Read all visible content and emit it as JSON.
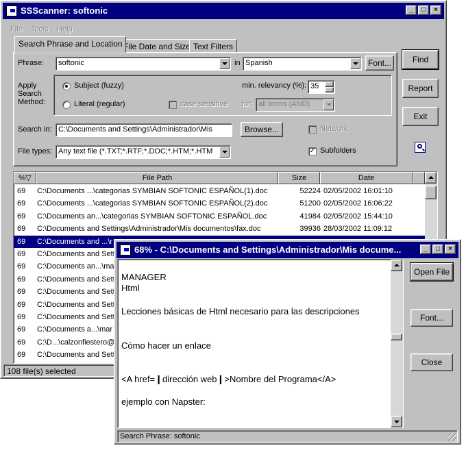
{
  "main_window": {
    "title": "SSScanner: softonic",
    "menu": [
      "File",
      "Tools",
      "Help"
    ],
    "tabs": [
      "Search Phrase and Location",
      "File Date and Size",
      "Text Filters"
    ],
    "phrase_label": "Phrase:",
    "phrase_value": "softonic",
    "in_label": "in",
    "language_value": "Spanish",
    "font_button": "Font...",
    "apply_label": "Apply\nSearch\nMethod:",
    "method_subject": "Subject (fuzzy)",
    "method_literal": "Literal (regular)",
    "case_sensitive": "case sensitive",
    "min_relevancy_label": "min. relevancy (%):",
    "min_relevancy_value": "35",
    "for_label": "for:",
    "for_value": "all terms (AND)",
    "search_in_label": "Search in:",
    "search_in_value": "C:\\Documents and Settings\\Administrador\\Mis",
    "browse_button": "Browse...",
    "network_label": "Network",
    "file_types_label": "File types:",
    "file_types_value": "Any text file (*.TXT;*.RTF;*.DOC;*.HTM;*.HTM",
    "subfolders_label": "Subfolders",
    "subfolders_check": "✓",
    "buttons": {
      "find": "Find",
      "report": "Report",
      "exit": "Exit"
    },
    "columns": [
      "%▽",
      "File Path",
      "Size",
      "Date"
    ],
    "rows": [
      {
        "pct": "69",
        "path": "C:\\Documents ...\\categorias SYMBIAN SOFTONIC ESPAÑOL(1).doc",
        "size": "52224",
        "date": "02/05/2002 16:01:10"
      },
      {
        "pct": "69",
        "path": "C:\\Documents ...\\categorias SYMBIAN SOFTONIC ESPAÑOL(2).doc",
        "size": "51200",
        "date": "02/05/2002 16:06:22"
      },
      {
        "pct": "69",
        "path": "C:\\Documents an...\\categorias SYMBIAN SOFTONIC ESPAÑOL.doc",
        "size": "41984",
        "date": "02/05/2002 15:44:10"
      },
      {
        "pct": "69",
        "path": "C:\\Documents and Settings\\Administrador\\Mis documentos\\fax.doc",
        "size": "39936",
        "date": "28/03/2002 11:09:12"
      },
      {
        "pct": "69",
        "path": "C:\\Documents and ...\\r",
        "size": "",
        "date": ""
      },
      {
        "pct": "69",
        "path": "C:\\Documents and Sett",
        "size": "",
        "date": ""
      },
      {
        "pct": "69",
        "path": "C:\\Documents an...\\ma",
        "size": "",
        "date": ""
      },
      {
        "pct": "69",
        "path": "C:\\Documents and Sett",
        "size": "",
        "date": ""
      },
      {
        "pct": "69",
        "path": "C:\\Documents and Sett",
        "size": "",
        "date": ""
      },
      {
        "pct": "69",
        "path": "C:\\Documents and Sett",
        "size": "",
        "date": ""
      },
      {
        "pct": "69",
        "path": "C:\\Documents and Sett",
        "size": "",
        "date": ""
      },
      {
        "pct": "69",
        "path": "C:\\Documents a...\\mar",
        "size": "",
        "date": ""
      },
      {
        "pct": "69",
        "path": "C:\\D...\\calzonfiestero@",
        "size": "",
        "date": ""
      },
      {
        "pct": "69",
        "path": "C:\\Documents and Sett",
        "size": "",
        "date": ""
      }
    ],
    "status": "108 file(s) selected"
  },
  "preview_window": {
    "title": "68% - C:\\Documents and Settings\\Administrador\\Mis docume...",
    "lines": [
      "MANAGER",
      "Html",
      "Lecciones básicas de Html necesario para las descripciones",
      "Cómo hacer un enlace",
      "<A href=❙dirección web❙>Nombre del Programa</A>",
      "ejemplo con Napster:"
    ],
    "buttons": {
      "open_file": "Open File",
      "font": "Font...",
      "close": "Close"
    },
    "status": "Search Phrase: softonic"
  }
}
